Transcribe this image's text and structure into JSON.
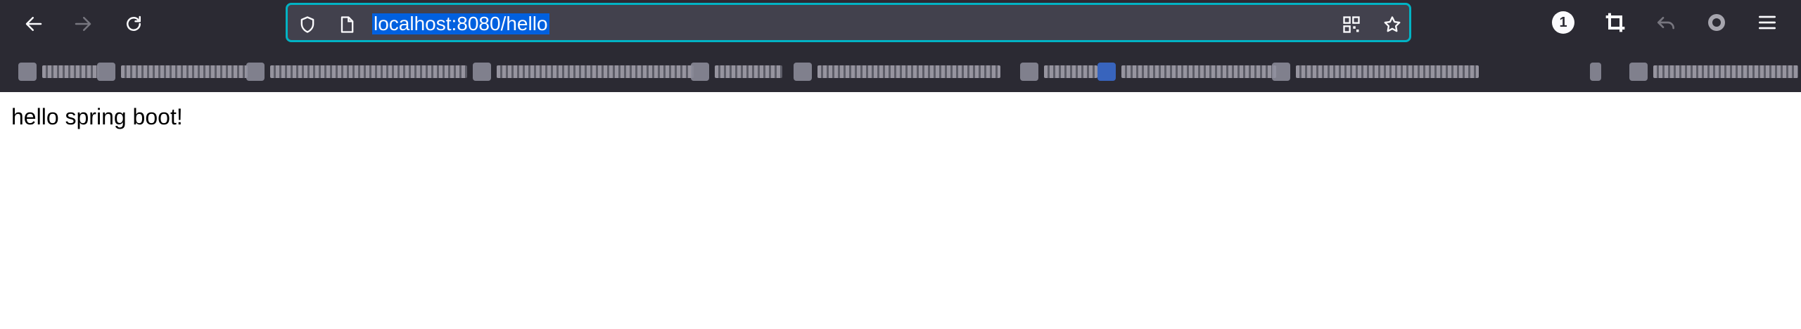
{
  "browser": {
    "url": "localhost:8080/hello",
    "notification_count": "1",
    "icons": [
      "back-icon",
      "forward-icon",
      "reload-icon",
      "shield-icon",
      "page-icon",
      "qr-code-icon",
      "star-icon",
      "crop-icon",
      "undo-icon",
      "profile-icon",
      "menu-icon"
    ]
  },
  "bookmarks": {
    "obscured": true
  },
  "page": {
    "body_text": "hello spring boot!"
  },
  "colors": {
    "chrome_bg": "#2b2a33",
    "urlbar_bg": "#42414d",
    "focus_ring": "#00b3c4",
    "selection": "#0060df"
  }
}
